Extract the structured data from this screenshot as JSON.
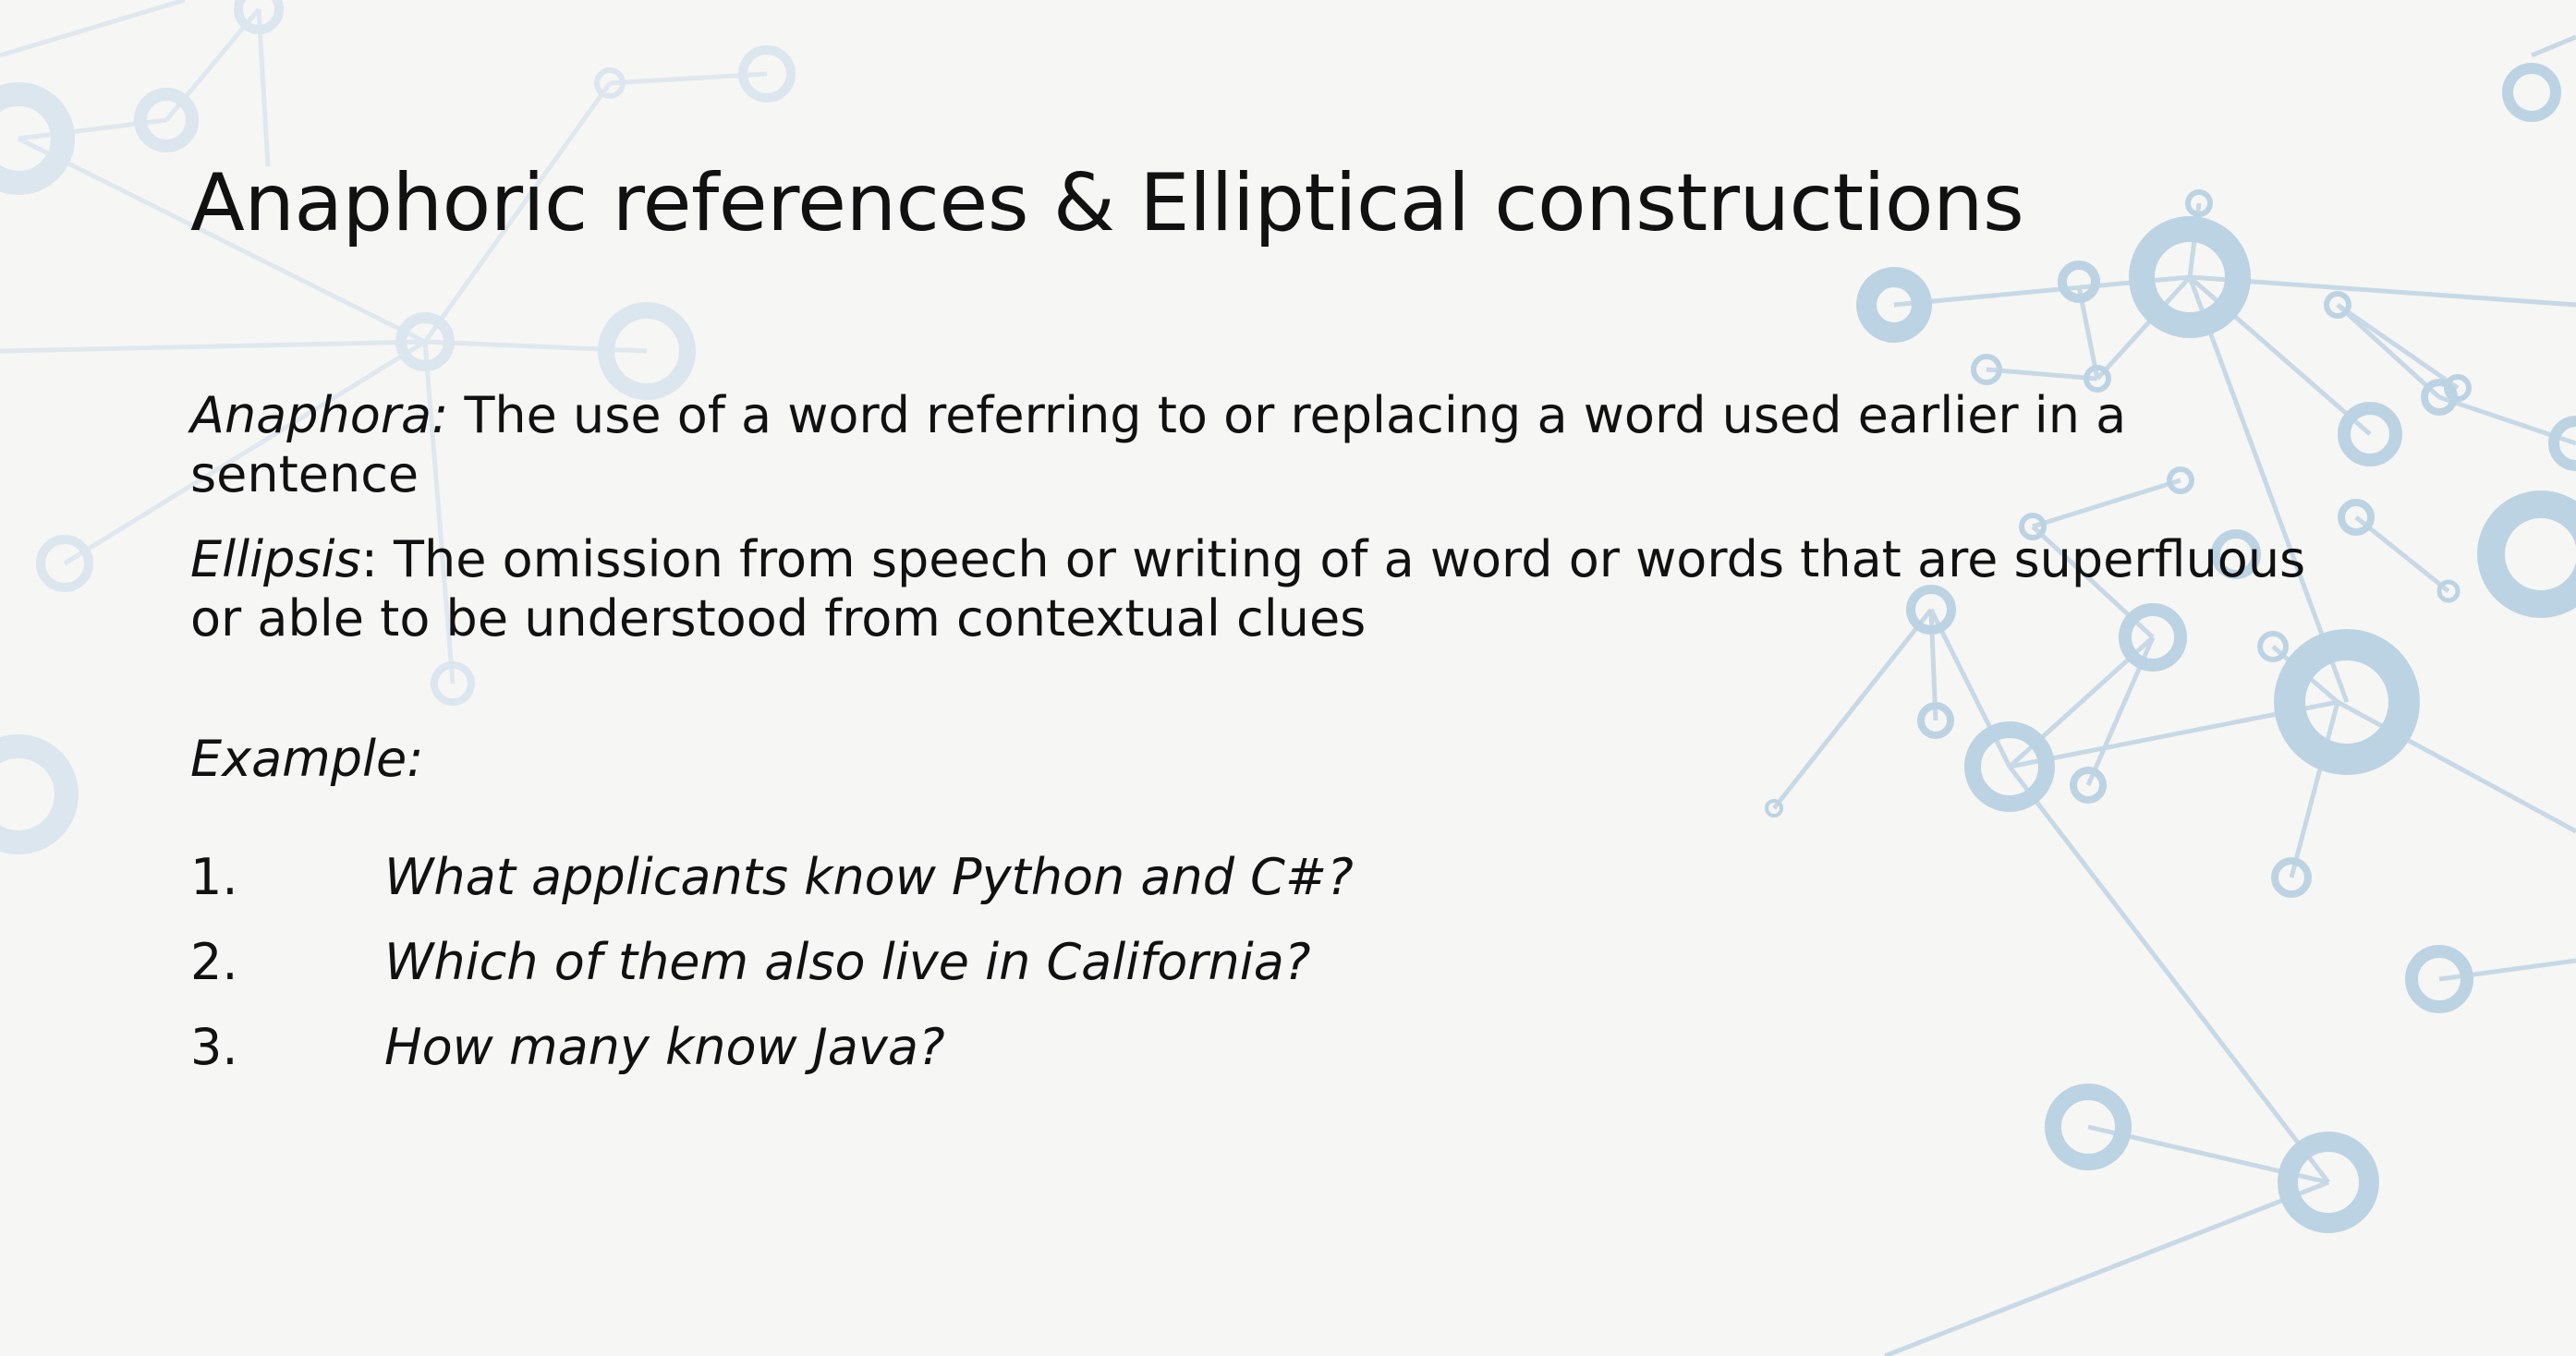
{
  "slide": {
    "title": "Anaphoric references & Elliptical constructions",
    "definitions": [
      {
        "term": "Anaphora:",
        "text": " The use of a word referring to or replacing a word used earlier in a sentence"
      },
      {
        "term": "Ellipsis",
        "text": ": The omission from speech or writing of a word or words that are superfluous or able to be understood from contextual clues"
      }
    ],
    "example_label": "Example:",
    "examples": [
      {
        "number": "1.",
        "text": "What applicants know Python and C#?"
      },
      {
        "number": "2.",
        "text": "Which of them also live in California?"
      },
      {
        "number": "3.",
        "text": "How many know Java?"
      }
    ]
  },
  "theme": {
    "background": "#f6f6f4",
    "text": "#111111",
    "network_accent": "#bcd3e3"
  }
}
